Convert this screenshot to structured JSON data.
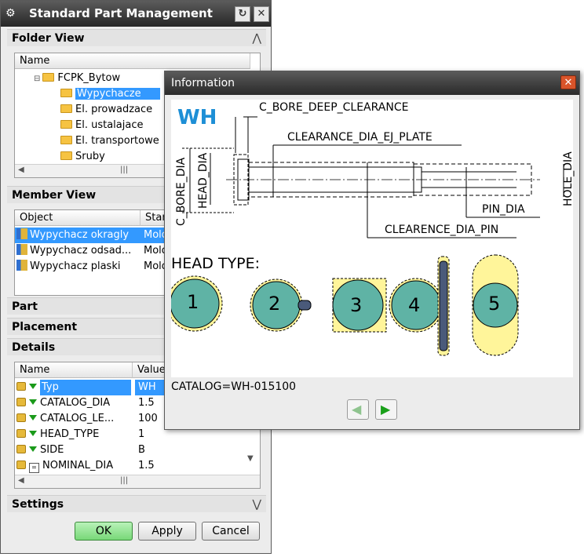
{
  "main_window": {
    "title": "Standard Part Management",
    "title_icon": "gear-icon",
    "refresh_icon": "refresh-icon",
    "close_icon": "close-icon"
  },
  "sections": {
    "folder_view": "Folder View",
    "member_view": "Member View",
    "part": "Part",
    "placement": "Placement",
    "details": "Details",
    "settings": "Settings"
  },
  "folder_tree": {
    "column": "Name",
    "root": "FCPK_Bytow",
    "items": [
      "Wypychacze",
      "El. prowadzace",
      "El. ustalajace",
      "El. transportowe",
      "Sruby"
    ],
    "selected": "Wypychacze"
  },
  "member_list": {
    "columns": [
      "Object",
      "Stan"
    ],
    "rows": [
      {
        "object": "Wypychacz okragly",
        "stan": "Mold"
      },
      {
        "object": "Wypychacz odsad...",
        "stan": "Mold"
      },
      {
        "object": "Wypychacz plaski",
        "stan": "Mold"
      }
    ]
  },
  "details_table": {
    "columns": [
      "Name",
      "Value"
    ],
    "rows": [
      {
        "name": "Typ",
        "value": "WH"
      },
      {
        "name": "CATALOG_DIA",
        "value": "1.5"
      },
      {
        "name": "CATALOG_LE...",
        "value": "100"
      },
      {
        "name": "HEAD_TYPE",
        "value": "1"
      },
      {
        "name": "SIDE",
        "value": "B"
      },
      {
        "name": "NOMINAL_DIA",
        "value": "1.5"
      }
    ]
  },
  "buttons": {
    "ok": "OK",
    "apply": "Apply",
    "cancel": "Cancel"
  },
  "info_dialog": {
    "title": "Information",
    "code": "WH",
    "labels": {
      "c_bore_deep": "C_BORE_DEEP_CLEARANCE",
      "clearance_ej": "CLEARANCE_DIA_EJ_PLATE",
      "c_bore_dia": "C_BORE_DIA",
      "head_dia": "HEAD_DIA",
      "pin_dia": "PIN_DIA",
      "hole_dia": "HOLE_DIA",
      "clearence_pin": "CLEARENCE_DIA_PIN"
    },
    "head_type_label": "HEAD TYPE:",
    "head_types": [
      "1",
      "2",
      "3",
      "4",
      "5"
    ],
    "catalog": "CATALOG=WH-015100",
    "prev_icon": "arrow-left-icon",
    "next_icon": "arrow-right-icon"
  },
  "colors": {
    "selection": "#3399ff",
    "accent_blue": "#1e8fd6",
    "head_fill": "#5fb3a5",
    "yellow": "#fff59a",
    "ok_green": "#8fe38f"
  }
}
